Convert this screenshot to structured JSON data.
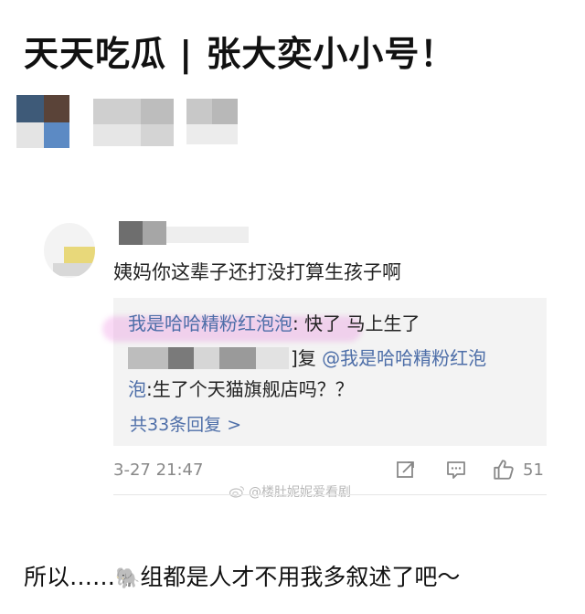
{
  "post": {
    "title": "天天吃瓜 | 张大奕小小号！"
  },
  "comment": {
    "text": "姨妈你这辈子还打没打算生孩子啊",
    "replies": [
      {
        "name": "我是哈哈精粉红泡泡",
        "separator": ": ",
        "text": "快了  马上生了"
      },
      {
        "mention_prefix": "]复 ",
        "mention": "@我是哈哈精粉红泡",
        "mention_cont": "泡",
        "text": ":生了个天猫旗舰店吗？？"
      }
    ],
    "more_replies": "共33条回复 >",
    "timestamp": "3-27 21:47",
    "like_count": "51"
  },
  "watermark": {
    "text": "@楼肚妮妮爱看剧"
  },
  "footer": {
    "prefix": "所以……",
    "emoji": "🐘",
    "suffix": "组都是人才不用我多叙述了吧～"
  },
  "icons": {
    "share": "share-icon",
    "comment": "comment-icon",
    "like": "thumbs-up-icon",
    "weibo": "weibo-icon"
  },
  "colors": {
    "link": "#4d6ea8",
    "highlight": "#e878dc",
    "muted": "#888888",
    "reply_bg": "#f3f3f3"
  }
}
